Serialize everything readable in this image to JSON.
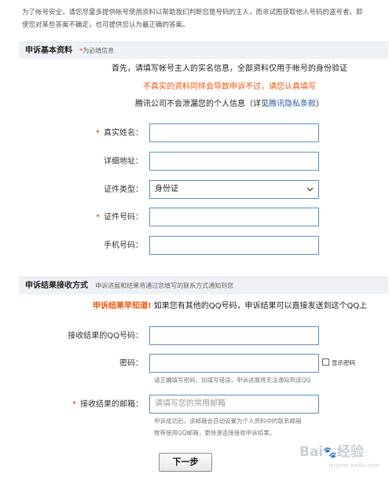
{
  "intro": {
    "line1": "为了帐号安全，请您尽量多提供帐号使用资料以帮助我们判断您是号码的主人，而非试图获取他人号码的盗号者。即",
    "line2": "使您对某些答案不确定，也可提供您认为最正确的答案。"
  },
  "basic_section": {
    "title": "申诉基本资料",
    "required_mark": "*",
    "required_note": "为必填信息",
    "notice_line1": "首先，请填写帐号主人的实名信息，全部资料仅用于帐号的身份验证",
    "notice_line2": "不真实的资料同样会导致申诉不过，请您认真填写",
    "notice_line3_prefix": "腾讯公司不会泄漏您的个人信息（详见",
    "notice_line3_link": "腾讯隐私条款",
    "notice_line3_suffix": "）",
    "fields": [
      {
        "label": "真实姓名：",
        "required": "*",
        "value": ""
      },
      {
        "label": "详细地址：",
        "required": "",
        "value": ""
      },
      {
        "label": "证件类型：",
        "required": "",
        "value": "身份证"
      },
      {
        "label": "证件号码：",
        "required": "*",
        "value": ""
      },
      {
        "label": "手机号码：",
        "required": "",
        "value": ""
      }
    ]
  },
  "result_section": {
    "title": "申诉结果接收方式",
    "subtitle": "申诉进展和结果将通过您填写的联系方式通知到您",
    "notice_highlight": "申诉结果早知道!",
    "notice_text": "如果您有其他的QQ号码，申诉结果可以直接发送到这个QQ上",
    "qq_label": "接收结果的QQ号码：",
    "qq_value": "",
    "password_label": "密码：",
    "password_value": "",
    "show_password_label": "显示密码",
    "password_hint": "请正确填写密码，如填写错误，申诉进展将无法通知到该QQ",
    "email_required": "*",
    "email_label": "接收结果的邮箱：",
    "email_placeholder": "请填写您的常用邮箱",
    "email_hint_line1": "申诉成功后，该邮箱会自动设置为个人资料中的联系邮箱",
    "email_hint_line2": "推荐使用QQ邮箱，更快速连接接收申诉结果。"
  },
  "next_button": "下一步",
  "watermark": {
    "brand": "Bai",
    "brand2": "经验",
    "url": "jingyan.baidu.com"
  },
  "icons": {
    "select_chevron": "chevron-down-icon",
    "checkbox": "checkbox-icon"
  },
  "colors": {
    "required": "#e03a1e",
    "warning": "#f2550b",
    "link": "#2b5aa3",
    "input_border": "#5a8fc9"
  }
}
